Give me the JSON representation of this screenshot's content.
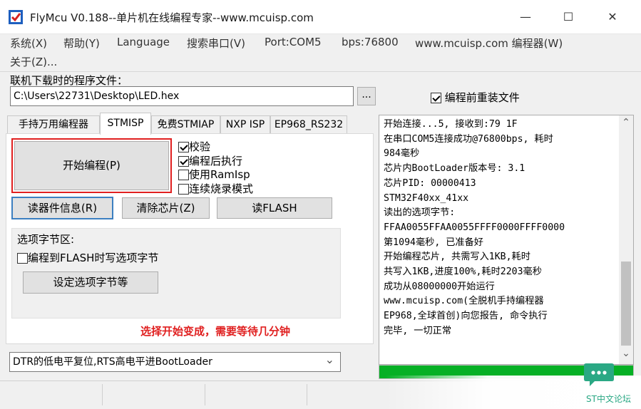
{
  "window": {
    "title": "FlyMcu V0.188--单片机在线编程专家--www.mcuisp.com",
    "minimize_glyph": "—",
    "maximize_glyph": "☐",
    "close_glyph": "✕"
  },
  "menu": [
    "系统(X)",
    "帮助(Y)",
    "Language",
    "搜索串口(V)",
    "Port:COM5",
    "bps:76800",
    "www.mcuisp.com 编程器(W)",
    "关于(Z)..."
  ],
  "hex": {
    "label": "联机下载时的程序文件：",
    "value": "C:\\Users\\22731\\Desktop\\LED.hex",
    "browse_label": "...",
    "reload_label": "编程前重装文件",
    "reload_checked": true
  },
  "tabs": [
    "手持万用编程器",
    "STMISP",
    "免费STMIAP",
    "NXP ISP",
    "EP968_RS232"
  ],
  "stmisp": {
    "start_button": "开始编程(P)",
    "options": [
      {
        "label": "校验",
        "checked": true
      },
      {
        "label": "编程后执行",
        "checked": true
      },
      {
        "label": "使用RamIsp",
        "checked": false
      },
      {
        "label": "连续烧录模式",
        "checked": false
      }
    ],
    "read_info_button": "读器件信息(R)",
    "erase_button": "清除芯片(Z)",
    "read_flash_button": "读FLASH",
    "option_bytes": {
      "group_label": "选项字节区:",
      "write_option_label": "编程到FLASH时写选项字节",
      "write_option_checked": false,
      "set_button": "设定选项字节等"
    },
    "annotation": "选择开始变成，需要等待几分钟"
  },
  "dtr_select": {
    "value": "DTR的低电平复位,RTS高电平进BootLoader",
    "arrow_glyph": "⌄"
  },
  "log": {
    "lines": [
      "开始连接...5, 接收到:79 1F",
      "在串口COM5连接成功@76800bps, 耗时",
      "984毫秒",
      "芯片内BootLoader版本号: 3.1",
      "芯片PID: 00000413",
      "STM32F40xx_41xx",
      "读出的选项字节:",
      "FFAA0055FFAA0055FFFF0000FFFF0000",
      "第1094毫秒, 已准备好",
      "开始编程芯片, 共需写入1KB,耗时",
      "共写入1KB,进度100%,耗时2203毫秒",
      "成功从08000000开始运行",
      "www.mcuisp.com(全脱机手持编程器",
      "EP968,全球首创)向您报告, 命令执行",
      "完毕, 一切正常"
    ],
    "scroll_up_glyph": "⌃",
    "scroll_down_glyph": "⌄"
  },
  "progress": {
    "fraction": 1.0,
    "color": "#06b025"
  },
  "watermark": {
    "text": "ST中文论坛",
    "color": "#2aa884"
  },
  "colors": {
    "highlight_red": "#e02020",
    "focus_blue": "#3c7fc1"
  }
}
